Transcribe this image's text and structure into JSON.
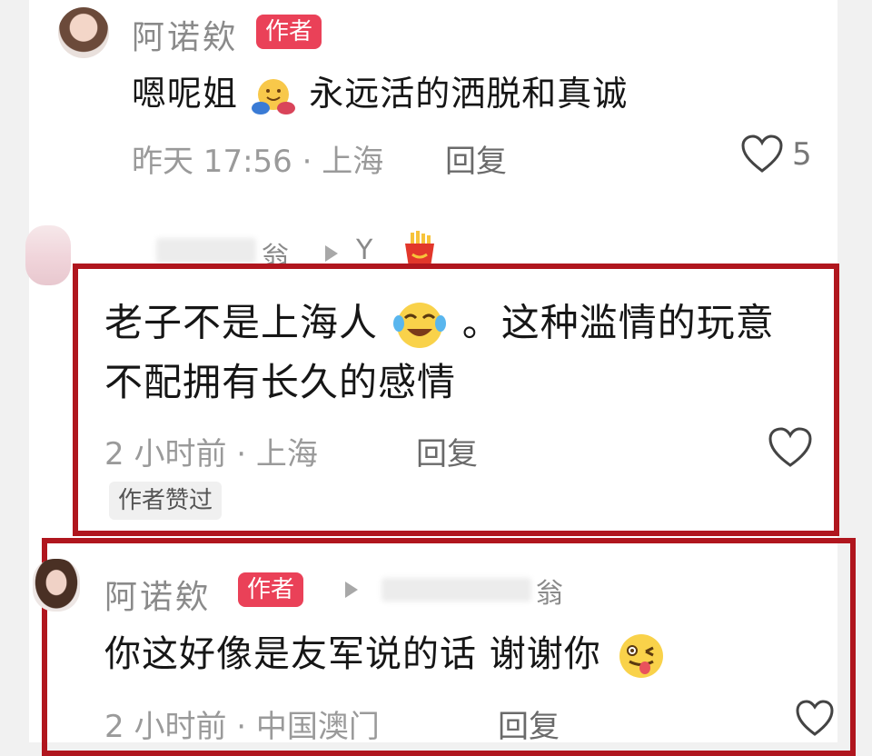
{
  "comment1": {
    "user_name": "阿诺欸",
    "author_badge": "作者",
    "text_before_emoji": "嗯呢姐",
    "emoji": "hug-emoji",
    "text_after_emoji": "永远活的洒脱和真诚",
    "time_location": "昨天 17:56 · 上海",
    "reply_label": "回复",
    "like_count": "5"
  },
  "comment2": {
    "user_name_fragment": "翁",
    "reply_target": "Y",
    "emoji": "fries-emoji",
    "line1_before_emoji": "老子不是上海人",
    "line1_emoji": "laugh-cry-emoji",
    "line1_after_emoji": "。这种滥情的玩意",
    "line2": "不配拥有长久的感情",
    "time_location": "2 小时前 · 上海",
    "reply_label": "回复",
    "author_liked_tag": "作者赞过"
  },
  "comment3": {
    "user_name": "阿诺欸",
    "author_badge": "作者",
    "reply_target_fragment": "翁",
    "text_before_emoji": "你这好像是友军说的话 谢谢你",
    "emoji": "wink-tongue-emoji",
    "time_location": "2 小时前 · 中国澳门",
    "reply_label": "回复"
  },
  "colors": {
    "badge": "#ea4158",
    "highlight_border": "#b0161e",
    "meta_text": "#9a9a9a"
  }
}
